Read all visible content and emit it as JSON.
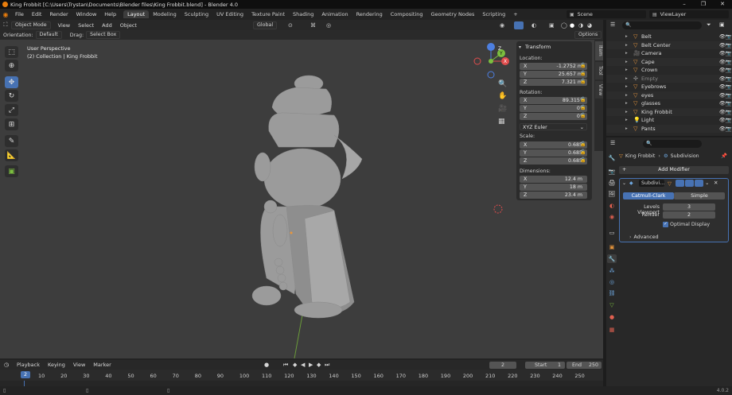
{
  "window": {
    "title": "King Frobbit [C:\\Users\\Trystan\\Documents\\Blender files\\King Frobbit.blend] - Blender 4.0"
  },
  "menubar": {
    "items": [
      "File",
      "Edit",
      "Render",
      "Window",
      "Help"
    ],
    "workspaces": [
      "Layout",
      "Modeling",
      "Sculpting",
      "UV Editing",
      "Texture Paint",
      "Shading",
      "Animation",
      "Rendering",
      "Compositing",
      "Geometry Nodes",
      "Scripting"
    ],
    "active_workspace": "Layout",
    "add_tab": "+",
    "scene": "Scene",
    "view_layer": "ViewLayer"
  },
  "viewport_header": {
    "mode": "Object Mode",
    "menus": [
      "View",
      "Select",
      "Add",
      "Object"
    ],
    "transform_orientation": "Global",
    "options": "Options"
  },
  "tool_header": {
    "orientation_label": "Orientation:",
    "orientation_value": "Default",
    "drag_label": "Drag:",
    "drag_value": "Select Box"
  },
  "viewport": {
    "perspective": "User Perspective",
    "collection": "(2) Collection | King Frobbit",
    "gizmo": {
      "x": "X",
      "y": "Y",
      "z": "Z"
    }
  },
  "npanel": {
    "title": "Transform",
    "location_label": "Location:",
    "location": [
      {
        "axis": "X",
        "value": "-1.2752 m"
      },
      {
        "axis": "Y",
        "value": "25.657 m"
      },
      {
        "axis": "Z",
        "value": "7.321 m"
      }
    ],
    "rotation_label": "Rotation:",
    "rotation": [
      {
        "axis": "X",
        "value": "89.315°"
      },
      {
        "axis": "Y",
        "value": "0°"
      },
      {
        "axis": "Z",
        "value": "0°"
      }
    ],
    "rotation_mode": "XYZ Euler",
    "scale_label": "Scale:",
    "scale": [
      {
        "axis": "X",
        "value": "0.685"
      },
      {
        "axis": "Y",
        "value": "0.685"
      },
      {
        "axis": "Z",
        "value": "0.685"
      }
    ],
    "dimensions_label": "Dimensions:",
    "dimensions": [
      {
        "axis": "X",
        "value": "12.4 m"
      },
      {
        "axis": "Y",
        "value": "18 m"
      },
      {
        "axis": "Z",
        "value": "23.4 m"
      }
    ],
    "tabs": [
      "Item",
      "Tool",
      "View"
    ]
  },
  "timeline": {
    "menus": [
      "Playback",
      "Keying",
      "View",
      "Marker"
    ],
    "current_frame": "2",
    "start_label": "Start",
    "start": "1",
    "end_label": "End",
    "end": "250",
    "ruler": [
      "10",
      "20",
      "30",
      "40",
      "50",
      "60",
      "70",
      "80",
      "90",
      "100",
      "110",
      "120",
      "130",
      "140",
      "150",
      "160",
      "170",
      "180",
      "190",
      "200",
      "210",
      "220",
      "230",
      "240",
      "250"
    ],
    "playhead": "2"
  },
  "outliner": {
    "items": [
      {
        "name": "Belt"
      },
      {
        "name": "Belt Center"
      },
      {
        "name": "Camera"
      },
      {
        "name": "Cape"
      },
      {
        "name": "Crown"
      },
      {
        "name": "Empty"
      },
      {
        "name": "Eyebrows"
      },
      {
        "name": "eyes"
      },
      {
        "name": "glasses"
      },
      {
        "name": "King Frobbit"
      },
      {
        "name": "Light"
      },
      {
        "name": "Pants"
      }
    ]
  },
  "properties": {
    "breadcrumb_object": "King Frobbit",
    "breadcrumb_modifier": "Subdivision",
    "add_modifier": "Add Modifier",
    "modifier_name": "Subdivi...",
    "catmull": "Catmull-Clark",
    "simple": "Simple",
    "levels_viewport_label": "Levels Viewport",
    "levels_viewport": "3",
    "render_label": "Render",
    "render": "2",
    "optimal_display": "Optimal Display",
    "advanced": "Advanced"
  },
  "status": {
    "version": "4.0.2"
  },
  "colors": {
    "accent": "#4772b3",
    "object_orange": "#e8963c",
    "mesh_green": "#6ec13f"
  }
}
